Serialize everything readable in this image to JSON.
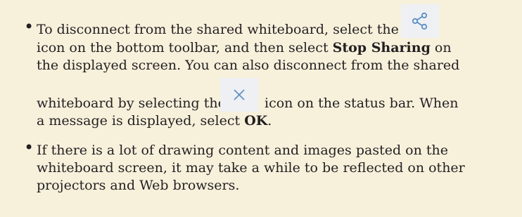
{
  "bullets": [
    {
      "lines": [
        {
          "before": "To disconnect from the shared whiteboard, select the"
        },
        {
          "before": "icon on the bottom toolbar, and then select ",
          "bold": "Stop Sharing",
          "after": " on"
        },
        {
          "before": "the displayed screen. You can also disconnect from the shared"
        },
        {
          "before": "whiteboard by selecting the",
          "after": "icon on the status bar. When"
        },
        {
          "before": "a message is displayed, select ",
          "bold": "OK",
          "after": "."
        }
      ]
    },
    {
      "lines": [
        {
          "before": "If there is a lot of drawing content and images pasted on the"
        },
        {
          "before": "whiteboard screen, it may take a while to be reflected on other"
        },
        {
          "before": "projectors and Web browsers."
        }
      ]
    }
  ],
  "icons": {
    "share": "share-icon",
    "close": "close-icon"
  },
  "colors": {
    "background": "#f7f1dc",
    "text": "#231f20",
    "icon_stroke": "#5a8fc4",
    "icon_bg": "#eef0f4"
  }
}
